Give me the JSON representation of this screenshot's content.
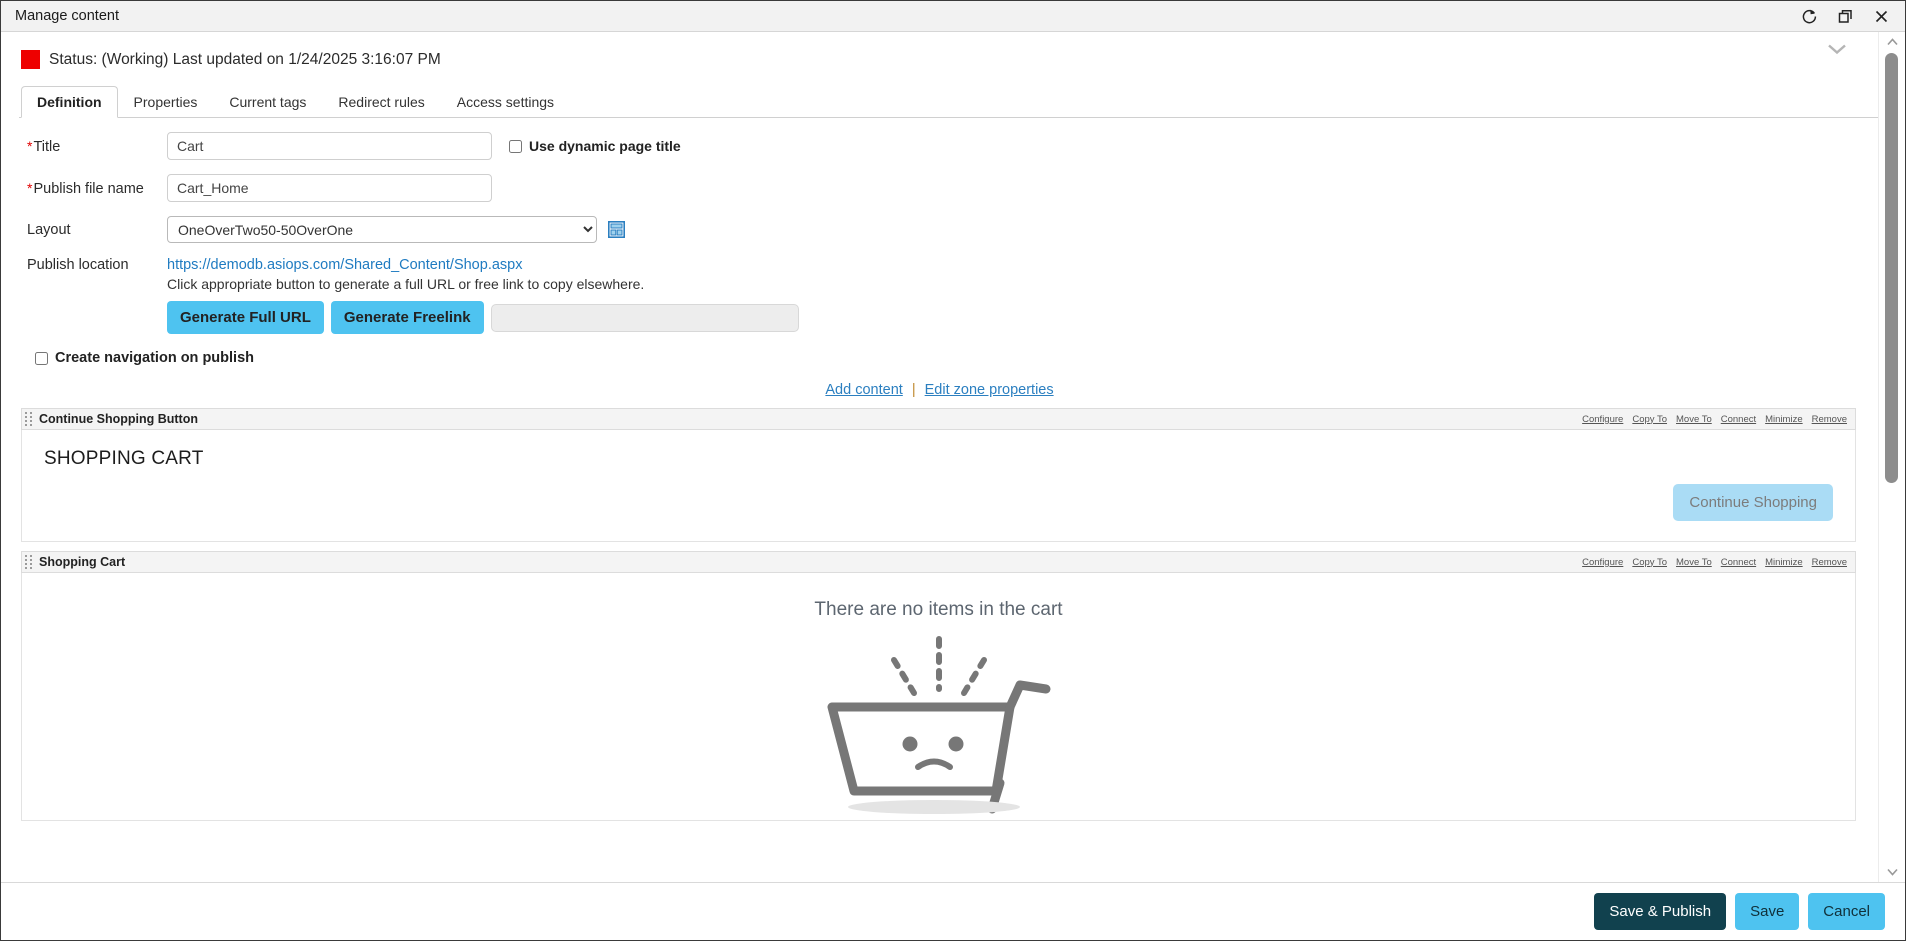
{
  "window": {
    "title": "Manage content",
    "controls": [
      {
        "name": "refresh-icon",
        "label": "Refresh"
      },
      {
        "name": "restore-icon",
        "label": "Restore"
      },
      {
        "name": "close-icon",
        "label": "Close"
      }
    ]
  },
  "status": {
    "text": "Status: (Working) Last updated on 1/24/2025 3:16:07 PM",
    "flag_color": "#ee0000",
    "collapse_label": "Collapse"
  },
  "tabs": [
    {
      "label": "Definition",
      "active": true
    },
    {
      "label": "Properties",
      "active": false
    },
    {
      "label": "Current tags",
      "active": false
    },
    {
      "label": "Redirect rules",
      "active": false
    },
    {
      "label": "Access settings",
      "active": false
    }
  ],
  "form": {
    "title_label": "Title",
    "title_value": "Cart",
    "dynamic_title_label": "Use dynamic page title",
    "dynamic_title_checked": false,
    "filename_label": "Publish file name",
    "filename_value": "Cart_Home",
    "layout_label": "Layout",
    "layout_value": "OneOverTwo50-50OverOne",
    "layout_options": [
      "OneOverTwo50-50OverOne"
    ],
    "publish_location_label": "Publish location",
    "publish_url": "https://demodb.asiops.com/Shared_Content/Shop.aspx",
    "publish_help": "Click appropriate button to generate a full URL or free link to copy elsewhere.",
    "generate_full_url_label": "Generate Full URL",
    "generate_freelink_label": "Generate Freelink",
    "freelink_value": "",
    "create_nav_label": "Create navigation on publish",
    "create_nav_checked": false
  },
  "zone_toolbar": {
    "add_content": "Add content",
    "separator": "|",
    "edit_zone_properties": "Edit zone properties"
  },
  "zone_actions": [
    "Configure",
    "Copy To",
    "Move To",
    "Connect",
    "Minimize",
    "Remove"
  ],
  "zones": [
    {
      "title": "Continue Shopping Button",
      "heading": "SHOPPING CART",
      "button_label": "Continue Shopping"
    },
    {
      "title": "Shopping Cart",
      "empty_message": "There are no items in the cart",
      "illustration": "sad-empty-cart"
    }
  ],
  "footer": {
    "save_publish_label": "Save & Publish",
    "save_label": "Save",
    "cancel_label": "Cancel"
  },
  "colors": {
    "accent_blue": "#4ec3f0",
    "primary_dark": "#11414e",
    "link_blue": "#2b7fc0",
    "status_red": "#ee0000",
    "illustration_gray": "#777777"
  }
}
